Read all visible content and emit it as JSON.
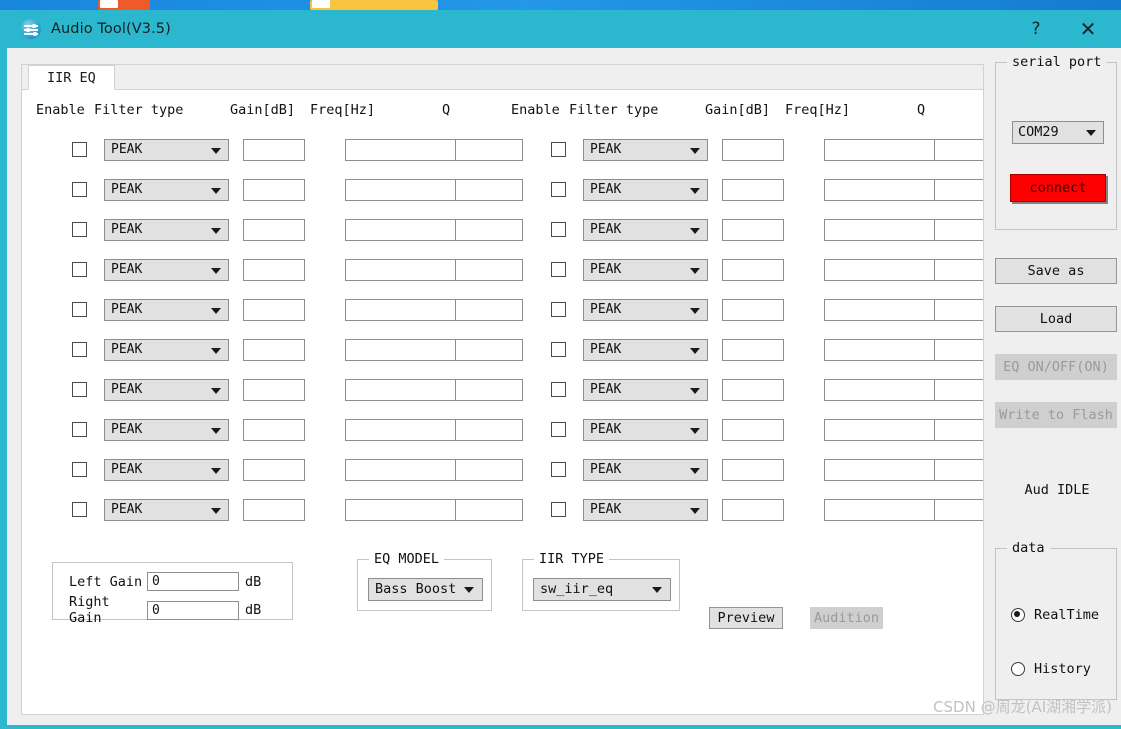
{
  "window": {
    "title": "Audio Tool(V3.5)",
    "icon": "equalizer-icon",
    "help_label": "?",
    "close_label": "✕",
    "titlebar_color": "#2bb8ce"
  },
  "tabs": [
    {
      "label": "IIR EQ",
      "active": true
    }
  ],
  "eq_table": {
    "headers": [
      "Enable",
      "Filter type",
      "Gain[dB]",
      "Freq[Hz]",
      "Q"
    ],
    "filter_type_value": "PEAK",
    "row_count": 10,
    "column_count": 2,
    "rows": [
      {
        "enabled": false,
        "filter_type": "PEAK",
        "gain": "",
        "freq": "",
        "q": ""
      },
      {
        "enabled": false,
        "filter_type": "PEAK",
        "gain": "",
        "freq": "",
        "q": ""
      },
      {
        "enabled": false,
        "filter_type": "PEAK",
        "gain": "",
        "freq": "",
        "q": ""
      },
      {
        "enabled": false,
        "filter_type": "PEAK",
        "gain": "",
        "freq": "",
        "q": ""
      },
      {
        "enabled": false,
        "filter_type": "PEAK",
        "gain": "",
        "freq": "",
        "q": ""
      },
      {
        "enabled": false,
        "filter_type": "PEAK",
        "gain": "",
        "freq": "",
        "q": ""
      },
      {
        "enabled": false,
        "filter_type": "PEAK",
        "gain": "",
        "freq": "",
        "q": ""
      },
      {
        "enabled": false,
        "filter_type": "PEAK",
        "gain": "",
        "freq": "",
        "q": ""
      },
      {
        "enabled": false,
        "filter_type": "PEAK",
        "gain": "",
        "freq": "",
        "q": ""
      },
      {
        "enabled": false,
        "filter_type": "PEAK",
        "gain": "",
        "freq": "",
        "q": ""
      }
    ]
  },
  "gain_panel": {
    "left_label": "Left Gain",
    "left_value": "0",
    "right_label": "Right Gain",
    "right_value": "0",
    "unit": "dB"
  },
  "eq_model": {
    "label": "EQ MODEL",
    "value": "Bass Boost"
  },
  "iir_type": {
    "label": "IIR TYPE",
    "value": "sw_iir_eq"
  },
  "actions": {
    "preview_label": "Preview",
    "preview_enabled": true,
    "audition_label": "Audition",
    "audition_enabled": false
  },
  "sidebar": {
    "serial_port": {
      "label": "serial port",
      "com_value": "COM29",
      "connect_label": "connect",
      "connect_color": "#ff0000"
    },
    "buttons": [
      {
        "label": "Save as",
        "enabled": true
      },
      {
        "label": "Load",
        "enabled": true
      },
      {
        "label": "EQ ON/OFF(ON)",
        "enabled": false
      },
      {
        "label": "Write to Flash",
        "enabled": false
      }
    ],
    "status": "Aud IDLE",
    "data_group": {
      "label": "data",
      "options": [
        {
          "label": "RealTime",
          "selected": true
        },
        {
          "label": "History",
          "selected": false
        }
      ]
    }
  },
  "watermark": "CSDN @周龙(AI湖湘学派)"
}
